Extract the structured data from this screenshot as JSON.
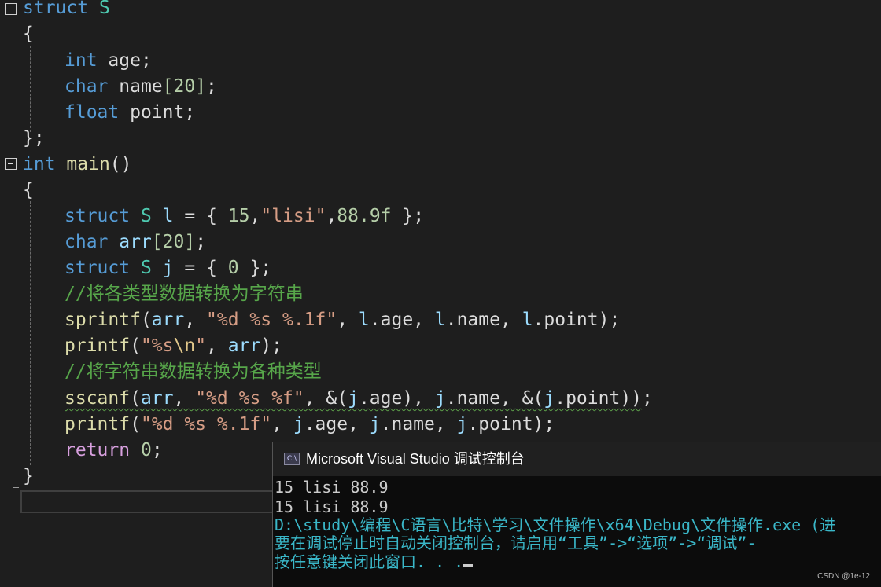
{
  "editor": {
    "struct_def": {
      "kw": "struct",
      "name": "S",
      "open": "{",
      "close": "};"
    },
    "fields": [
      {
        "type": "int",
        "name": "age;"
      },
      {
        "type": "char",
        "name": "name",
        "index": "[20]",
        "end": ";"
      },
      {
        "type": "float",
        "name": "point;"
      }
    ],
    "main_sig": {
      "kw": "int",
      "fn": "main",
      "parens": "()"
    },
    "main_open": "{",
    "main_close": "}",
    "stmt1": {
      "kw": "struct",
      "tp": "S",
      "var": "l",
      "eq": " = { ",
      "n1": "15",
      "str": "\"lisi\"",
      "n2": "88.9f",
      "end": " };"
    },
    "stmt2": {
      "kw": "char",
      "var": "arr",
      "idx": "[20]",
      "end": ";"
    },
    "stmt3": {
      "kw": "struct",
      "tp": "S",
      "var": "j",
      "eq": " = { ",
      "n": "0",
      "end": " };"
    },
    "comment1": "//将各类型数据转换为字符串",
    "stmt4": {
      "fn": "sprintf",
      "open": "(",
      "a": "arr",
      "sep1": ", ",
      "fmt": "\"%d %s %.1f\"",
      "sep2": ", ",
      "p1": "l",
      "f1": ".age",
      "sep3": ", ",
      "p2": "l",
      "f2": ".name",
      "sep4": ", ",
      "p3": "l",
      "f3": ".point",
      "end": ");"
    },
    "stmt5": {
      "fn": "printf",
      "open": "(",
      "fmt": "\"%s",
      "esc": "\\n",
      "q": "\"",
      "sep": ", ",
      "a": "arr",
      "end": ");"
    },
    "comment2": "//将字符串数据转换为各种类型",
    "stmt6": {
      "fn": "sscanf",
      "open": "(",
      "a": "arr",
      "sep1": ", ",
      "fmt": "\"%d %s %f\"",
      "sep2": ", &(",
      "p1": "j",
      "f1": ".age",
      "sep3": "), ",
      "p2": "j",
      "f2": ".name",
      "sep4": ", &(",
      "p3": "j",
      "f3": ".point",
      "close": "))",
      "end": ";"
    },
    "stmt7": {
      "fn": "printf",
      "open": "(",
      "fmt": "\"%d %s %.1f\"",
      "sep1": ", ",
      "p1": "j",
      "f1": ".age",
      "sep2": ", ",
      "p2": "j",
      "f2": ".name",
      "sep3": ", ",
      "p3": "j",
      "f3": ".point",
      "end": ");"
    },
    "stmt8": {
      "kw": "return",
      "n": "0",
      "end": ";"
    }
  },
  "console": {
    "icon_label": "C:\\",
    "title": "Microsoft Visual Studio 调试控制台",
    "lines": [
      "15 lisi 88.9",
      "15 lisi 88.9",
      "D:\\study\\编程\\C语言\\比特\\学习\\文件操作\\x64\\Debug\\文件操作.exe (进",
      "要在调试停止时自动关闭控制台，请启用“工具”->“选项”->“调试”-",
      "按任意键关闭此窗口. . ."
    ]
  },
  "watermark": "CSDN @1e-12",
  "colors": {
    "background": "#1e1e1e",
    "keyword": "#569cd6",
    "type": "#4ec9b0",
    "function": "#dcdcaa",
    "number": "#b5cea8",
    "string": "#d69d85",
    "comment": "#57a64a",
    "console_bg": "#0c0c0c",
    "console_cyan": "#3ab7c8"
  }
}
